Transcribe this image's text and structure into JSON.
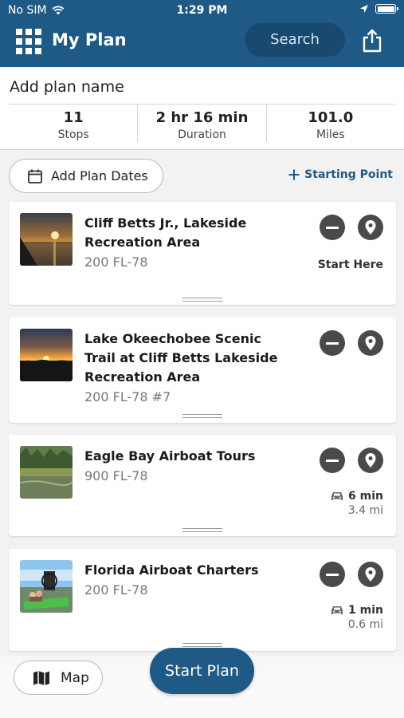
{
  "status_bar": {
    "carrier": "No SIM",
    "time": "1:29 PM"
  },
  "header": {
    "title": "My Plan",
    "search_label": "Search"
  },
  "summary": {
    "plan_name": "Add plan name",
    "stats": [
      {
        "value": "11",
        "label": "Stops"
      },
      {
        "value": "2 hr 16 min",
        "label": "Duration"
      },
      {
        "value": "101.0",
        "label": "Miles"
      }
    ]
  },
  "actions": {
    "add_dates": "Add Plan Dates",
    "starting_point": "Starting Point"
  },
  "stops": [
    {
      "title": "Cliff Betts Jr., Lakeside Recreation Area",
      "address": "200 FL-78",
      "note": "Start Here"
    },
    {
      "title": "Lake Okeechobee Scenic Trail at Cliff Betts Lakeside Recreation Area",
      "address": "200 FL-78 #7"
    },
    {
      "title": "Eagle Bay Airboat Tours",
      "address": "900 FL-78",
      "drive_time": "6 min",
      "drive_distance": "3.4 mi"
    },
    {
      "title": "Florida Airboat Charters",
      "address": "200 FL-78",
      "drive_time": "1 min",
      "drive_distance": "0.6 mi"
    }
  ],
  "footer": {
    "map_label": "Map",
    "start_plan_label": "Start Plan"
  },
  "colors": {
    "primary": "#1e5a85",
    "icon_dark": "#4a4a4a"
  }
}
